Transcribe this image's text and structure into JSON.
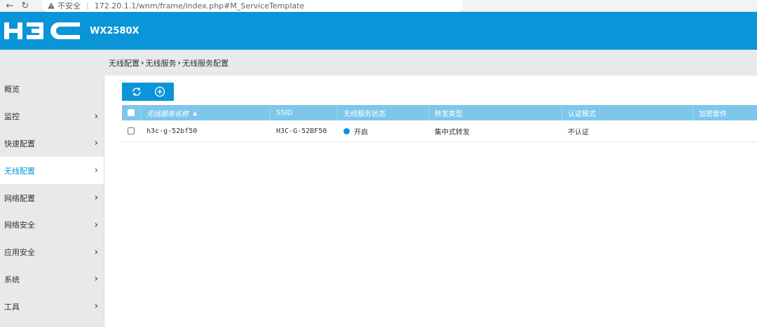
{
  "browser": {
    "security_label": "不安全",
    "url": "172.20.1.1/wnm/frame/index.php#M_ServiceTemplate"
  },
  "header": {
    "logo_text": "H3C",
    "model": "WX2580X",
    "bg_color": "#0a95d9"
  },
  "breadcrumb": {
    "items": [
      "无线配置",
      "无线服务",
      "无线服务配置"
    ],
    "separator": "›"
  },
  "sidebar": {
    "items": [
      {
        "label": "概览",
        "has_arrow": false
      },
      {
        "label": "监控",
        "has_arrow": true
      },
      {
        "label": "快速配置",
        "has_arrow": true
      },
      {
        "label": "无线配置",
        "has_arrow": true,
        "active": true
      },
      {
        "label": "网络配置",
        "has_arrow": true
      },
      {
        "label": "网络安全",
        "has_arrow": true
      },
      {
        "label": "应用安全",
        "has_arrow": true
      },
      {
        "label": "系统",
        "has_arrow": true
      },
      {
        "label": "工具",
        "has_arrow": true
      }
    ],
    "arrow": "›"
  },
  "toolbar": {
    "refresh_icon": "refresh-icon",
    "add_icon": "add-circle-icon"
  },
  "table": {
    "columns": [
      "无线服务名称",
      "SSID",
      "无线服务状态",
      "转发类型",
      "认证模式",
      "加密套件"
    ],
    "sort_indicator": "▲",
    "rows": [
      {
        "name": "h3c-g-52bf50",
        "ssid": "H3C-G-52BF50",
        "status": "开启",
        "forward": "集中式转发",
        "auth": "不认证",
        "cipher": ""
      }
    ]
  }
}
